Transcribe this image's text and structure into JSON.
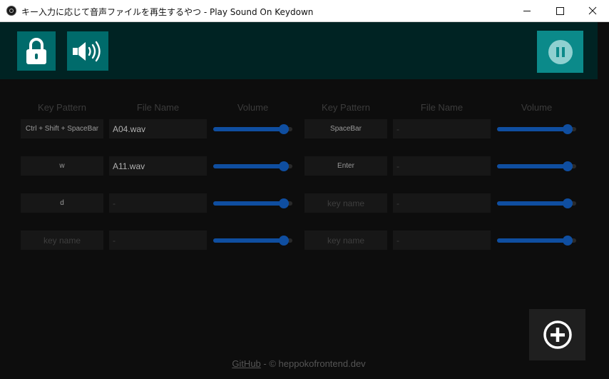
{
  "window": {
    "title": "キー入力に応じて音声ファイルを再生するやつ - Play Sound On Keydown"
  },
  "header": {
    "lock_icon": "lock-icon",
    "sound_icon": "speaker-volume-icon",
    "pause_icon": "pause-icon"
  },
  "columns": {
    "left": {
      "key": "Key Pattern",
      "file": "File Name",
      "volume": "Volume"
    },
    "right": {
      "key": "Key Pattern",
      "file": "File Name",
      "volume": "Volume"
    }
  },
  "rows": [
    {
      "left": {
        "key": "Ctrl + Shift + SpaceBar",
        "key_placeholder": "key name",
        "file": "A04.wav",
        "file_placeholder": "-",
        "volume": 0.95
      },
      "right": {
        "key": "SpaceBar",
        "key_placeholder": "key name",
        "file": "",
        "file_placeholder": "-",
        "volume": 0.95
      }
    },
    {
      "left": {
        "key": "w",
        "key_placeholder": "key name",
        "file": "A11.wav",
        "file_placeholder": "-",
        "volume": 0.95
      },
      "right": {
        "key": "Enter",
        "key_placeholder": "key name",
        "file": "",
        "file_placeholder": "-",
        "volume": 0.95
      }
    },
    {
      "left": {
        "key": "d",
        "key_placeholder": "key name",
        "file": "",
        "file_placeholder": "-",
        "volume": 0.95
      },
      "right": {
        "key": "",
        "key_placeholder": "key name",
        "file": "",
        "file_placeholder": "-",
        "volume": 0.95
      }
    },
    {
      "left": {
        "key": "",
        "key_placeholder": "key name",
        "file": "",
        "file_placeholder": "-",
        "volume": 0.95
      },
      "right": {
        "key": "",
        "key_placeholder": "key name",
        "file": "",
        "file_placeholder": "-",
        "volume": 0.95
      }
    }
  ],
  "add_button": {
    "icon": "plus-circle-icon"
  },
  "footer": {
    "link": "GitHub",
    "text": " - © heppokofrontend.dev"
  },
  "colors": {
    "header_bg": "#002323",
    "accent_button": "#006b6b",
    "pause_button": "#0b8a8a",
    "slider_fill": "#0f4ea0"
  }
}
